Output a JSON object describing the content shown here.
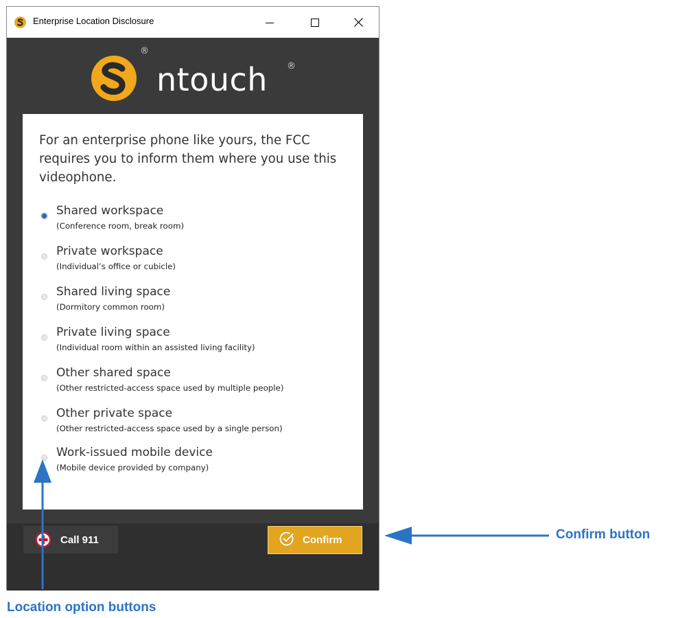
{
  "window": {
    "title": "Enterprise Location Disclosure"
  },
  "logo": {
    "wordmark": "ntouch",
    "registered_mark": "®"
  },
  "intro_text": "For an enterprise phone like yours, the FCC requires you to inform them where you use this videophone.",
  "options": [
    {
      "title": "Shared workspace",
      "subtitle": "(Conference room, break room)",
      "selected": true
    },
    {
      "title": "Private workspace",
      "subtitle": "(Individual’s office or cubicle)",
      "selected": false
    },
    {
      "title": "Shared living space",
      "subtitle": "(Dormitory common room)",
      "selected": false
    },
    {
      "title": "Private living space",
      "subtitle": "(Individual room within an assisted living facility)",
      "selected": false
    },
    {
      "title": "Other shared space",
      "subtitle": "(Other restricted-access space used by multiple people)",
      "selected": false
    },
    {
      "title": "Other private space",
      "subtitle": "(Other restricted-access space used by a single person)",
      "selected": false
    },
    {
      "title": "Work-issued mobile device",
      "subtitle": "(Mobile device provided by company)",
      "selected": false
    }
  ],
  "footer": {
    "call_label": "Call 911",
    "confirm_label": "Confirm"
  },
  "annotations": {
    "confirm": "Confirm button",
    "options": "Location option buttons"
  },
  "colors": {
    "accent": "#e3a51f",
    "annotation": "#2b74c4",
    "dialog_bg": "#3a3a3a"
  },
  "icons": [
    "ntouch-logo-icon",
    "minimize-icon",
    "maximize-icon",
    "close-icon",
    "emergency-cross-icon",
    "check-circle-icon",
    "arrow-left-icon",
    "arrow-up-icon"
  ]
}
